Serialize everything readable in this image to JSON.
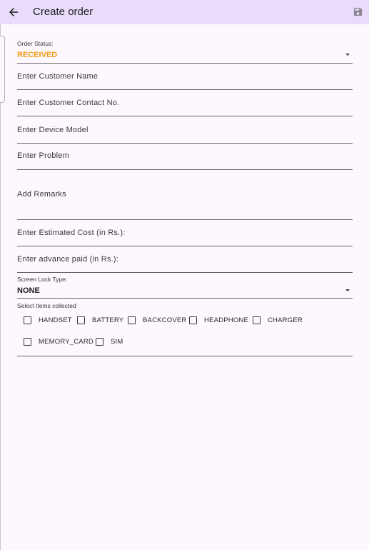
{
  "appbar": {
    "title": "Create order",
    "back_icon": "arrow-left-icon",
    "save_icon": "save-icon"
  },
  "form": {
    "order_status": {
      "label": "Order Status:",
      "value": "RECEIVED",
      "value_color": "#f29b16"
    },
    "customer_name": {
      "placeholder": "Enter Customer Name"
    },
    "customer_contact": {
      "placeholder": "Enter Customer Contact No."
    },
    "device_model": {
      "placeholder": "Enter Device Model"
    },
    "problem": {
      "placeholder": "Enter Problem"
    },
    "remarks": {
      "placeholder": "Add Remarks"
    },
    "estimated_cost": {
      "placeholder": "Enter Estimated Cost (in Rs.):"
    },
    "advance_paid": {
      "placeholder": "Enter advance paid (in Rs.):"
    },
    "screen_lock": {
      "label": "Screen Lock Type:",
      "value": "NONE"
    },
    "items": {
      "label": "Select Items collected",
      "options": [
        {
          "label": "HANDSET",
          "checked": false
        },
        {
          "label": "BATTERY",
          "checked": false
        },
        {
          "label": "BACKCOVER",
          "checked": false
        },
        {
          "label": "HEADPHONE",
          "checked": false
        },
        {
          "label": "CHARGER",
          "checked": false
        },
        {
          "label": "MEMORY_CARD",
          "checked": false
        },
        {
          "label": "SIM",
          "checked": false
        }
      ]
    }
  },
  "colors": {
    "appbar_bg": "#e9dcfb",
    "page_bg": "#fdf7fe",
    "accent": "#f29b16"
  }
}
